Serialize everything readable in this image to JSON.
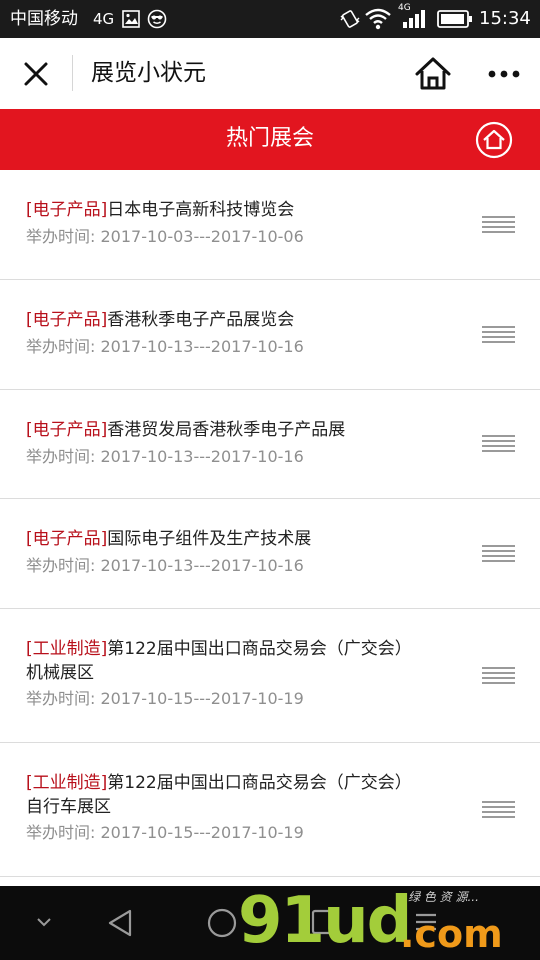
{
  "status_bar": {
    "carrier": "中国移动",
    "network": "4G",
    "net_label": "4G",
    "time": "15:34",
    "icons": [
      "gallery-icon",
      "face-icon",
      "vibrate-icon",
      "wifi-icon",
      "signal-icon",
      "battery-icon"
    ]
  },
  "nav": {
    "title": "展览小状元",
    "icons": [
      "close-icon",
      "home-icon",
      "more-icon"
    ]
  },
  "header": {
    "title": "热门展会",
    "icon": "home-circle-icon",
    "color": "#e2151f"
  },
  "colors": {
    "accent": "#e2151f",
    "category": "#b8101b",
    "date": "#8f8f8f"
  },
  "exhibitions": [
    {
      "category": "[电子产品]",
      "title": "日本电子高新科技博览会",
      "title_line2": "",
      "date_label": "举办时间:",
      "date_range": "2017-10-03---2017-10-06"
    },
    {
      "category": "[电子产品]",
      "title": "香港秋季电子产品展览会",
      "title_line2": "",
      "date_label": "举办时间:",
      "date_range": "2017-10-13---2017-10-16"
    },
    {
      "category": "[电子产品]",
      "title": "香港贸发局香港秋季电子产品展",
      "title_line2": "",
      "date_label": "举办时间:",
      "date_range": "2017-10-13---2017-10-16"
    },
    {
      "category": "[电子产品]",
      "title": "国际电子组件及生产技术展",
      "title_line2": "",
      "date_label": "举办时间:",
      "date_range": "2017-10-13---2017-10-16"
    },
    {
      "category": "[工业制造]",
      "title": "第122届中国出口商品交易会（广交会）",
      "title_line2": "机械展区",
      "date_label": "举办时间:",
      "date_range": "2017-10-15---2017-10-19"
    },
    {
      "category": "[工业制造]",
      "title": "第122届中国出口商品交易会（广交会）",
      "title_line2": "自行车展区",
      "date_label": "举办时间:",
      "date_range": "2017-10-15---2017-10-19"
    }
  ],
  "android_nav": {
    "icons": [
      "chevron-down-icon",
      "back-icon",
      "home-circle-icon",
      "recents-icon",
      "menu-icon"
    ]
  },
  "watermark": {
    "big": "91ud",
    "com": ".com",
    "sub": "绿 色 资 源..."
  }
}
